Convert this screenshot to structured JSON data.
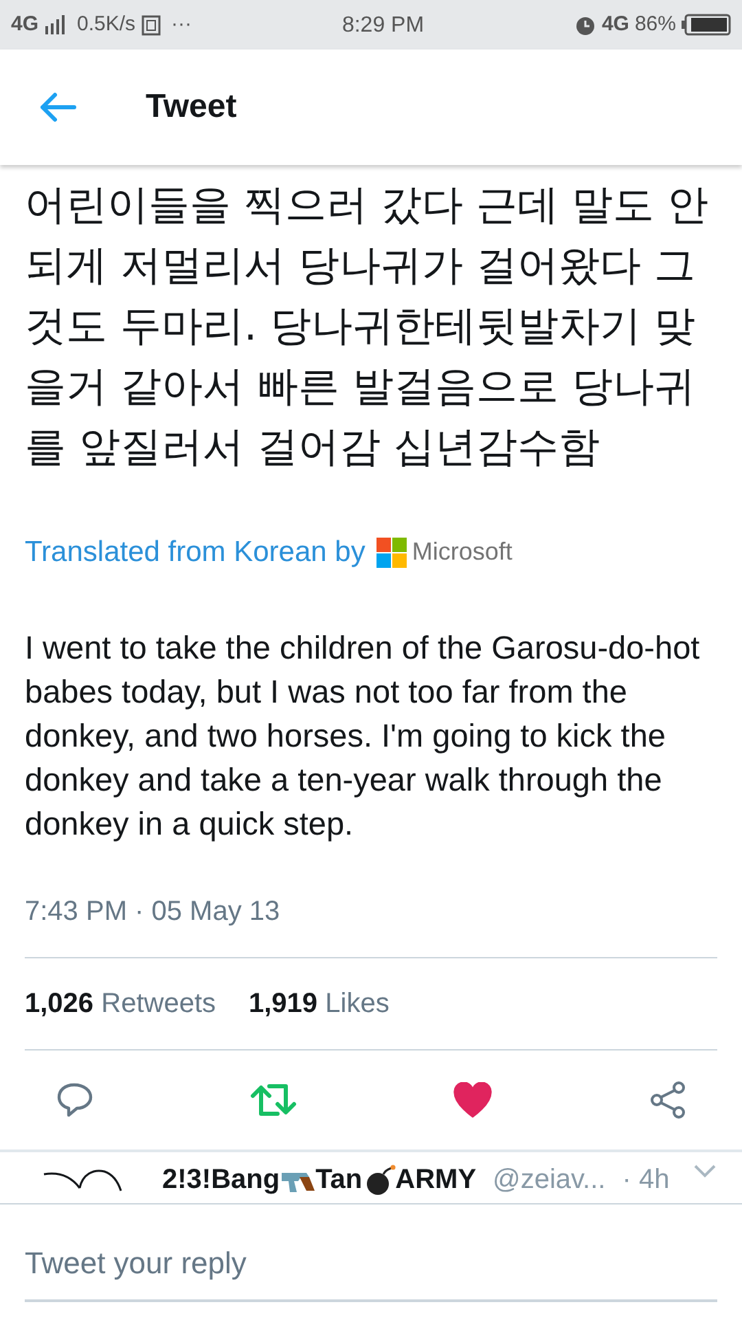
{
  "status_bar": {
    "network": "4G",
    "speed": "0.5K/s",
    "more": "···",
    "time": "8:29 PM",
    "data": "4G",
    "battery": "86%"
  },
  "header": {
    "title": "Tweet"
  },
  "tweet": {
    "text_lines": [
      "어린이들을 찍으러 갔다 근데 말도 안",
      "되게 저멀리서 당나귀가 걸어왔다 그",
      "것도 두마리. 당나귀한테뒷발차기 맞",
      "을거 같아서 빠른 발걸음으로 당나귀",
      "를 앞질러서 걸어감 십년감수함"
    ],
    "translation_label": "Translated from Korean by",
    "translator": "Microsoft",
    "translation": "I went to take the children of the Garosu-do-hot babes today, but I was not too far from the donkey, and two horses. I'm going to kick the donkey and take a ten-year walk through the donkey in a quick step.",
    "timestamp": "7:43 PM · 05 May 13",
    "stats": [
      {
        "count": "1,026",
        "label": "Retweets"
      },
      {
        "count": "1,919",
        "label": "Likes"
      }
    ],
    "actions": [
      {
        "kind": "reply",
        "on": false
      },
      {
        "kind": "retweet",
        "on": true
      },
      {
        "kind": "like",
        "on": true
      },
      {
        "kind": "share",
        "on": false
      }
    ]
  },
  "reply_preview": {
    "name_parts": [
      "2!3!Bang",
      "Tan",
      "ARMY"
    ],
    "handle": "@zeiav...",
    "time": "· 4h"
  },
  "reply_field": {
    "placeholder": "Tweet your reply"
  }
}
